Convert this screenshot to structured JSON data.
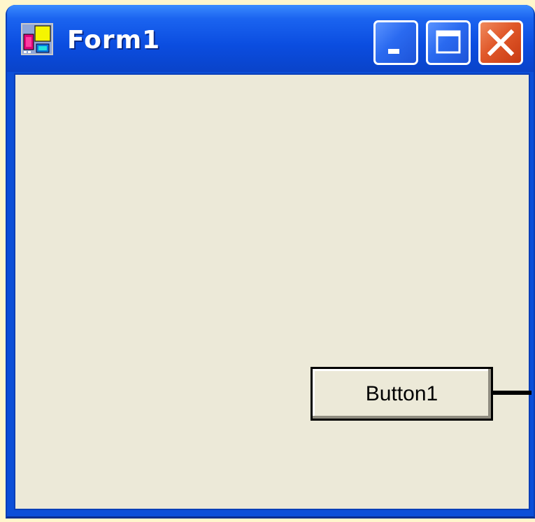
{
  "window": {
    "title": "Form1",
    "icon": "form-app-icon",
    "controls": {
      "minimize": "minimize-icon",
      "maximize": "maximize-icon",
      "close": "close-icon"
    }
  },
  "form": {
    "button1_label": "Button1"
  },
  "colors": {
    "titlebar": "#0b4de0",
    "client_bg": "#ece9d8",
    "close_button": "#e0582a"
  }
}
